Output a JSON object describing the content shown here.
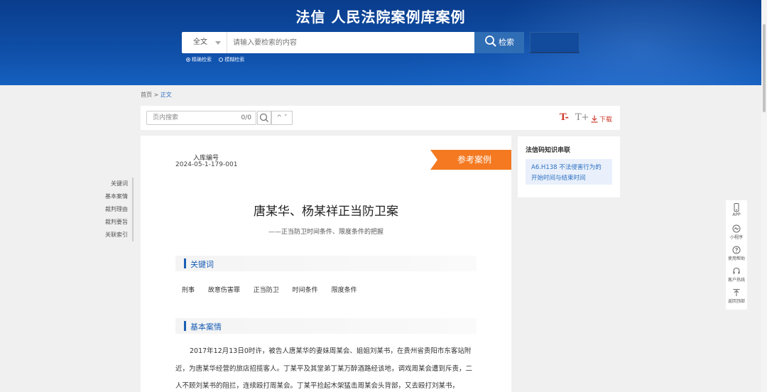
{
  "header": {
    "site_title": "法信 人民法院案例库案例",
    "search_scope": "全文",
    "search_placeholder": "请输入要检索的内容",
    "search_button": "检索",
    "mode_exact": "精确检索",
    "mode_fuzzy": "模糊检索"
  },
  "breadcrumb": {
    "home": "首页",
    "sep": ">",
    "current": "正文"
  },
  "toolbar": {
    "page_search_placeholder": "页内搜索",
    "page_search_count": "0/0",
    "updown": "^ ˅",
    "font_decrease": "T-",
    "font_increase": "T+",
    "download": "下载"
  },
  "left_nav": [
    "关键词",
    "基本案情",
    "裁判理由",
    "裁判要旨",
    "关联索引"
  ],
  "case": {
    "ref_label": "入库编号",
    "ref_number": "2024-05-1-179-001",
    "badge": "参考案例",
    "title": "唐某华、杨某祥正当防卫案",
    "subtitle": "——正当防卫时间条件、限度条件的把握",
    "section_keywords": "关键词",
    "keywords": [
      "刑事",
      "故意伤害罪",
      "正当防卫",
      "时间条件",
      "限度条件"
    ],
    "section_facts": "基本案情",
    "facts_text": "2017年12月13日0时许，被告人唐某华的妻妹周某会、姐姐刘某书，在贵州省贵阳市东客站附近，为唐某华经营的旅店招揽客人。丁某平及其堂弟丁某万醉酒路经该地，调戏周某会遭到斥责，二人不顾刘某书的阻拦，连续殴打周某会。丁某平捡起木架猛击周某会头背部，又去殴打刘某书，"
  },
  "right_panel": {
    "title": "法信码知识串联",
    "link_text": "A6.H138 不法侵害行为的开始时间与结束时间"
  },
  "float_bar": [
    {
      "label": "APP",
      "icon": "phone-icon"
    },
    {
      "label": "小程序",
      "icon": "mini-program-icon"
    },
    {
      "label": "使用帮助",
      "icon": "help-icon"
    },
    {
      "label": "客户热线",
      "icon": "headset-icon"
    },
    {
      "label": "返回顶部",
      "icon": "back-to-top-icon"
    }
  ],
  "colors": {
    "header_blue": "#0f4fa8",
    "accent_blue": "#1a5fb4",
    "badge_orange": "#f47920",
    "download_red": "#d03a2e"
  }
}
